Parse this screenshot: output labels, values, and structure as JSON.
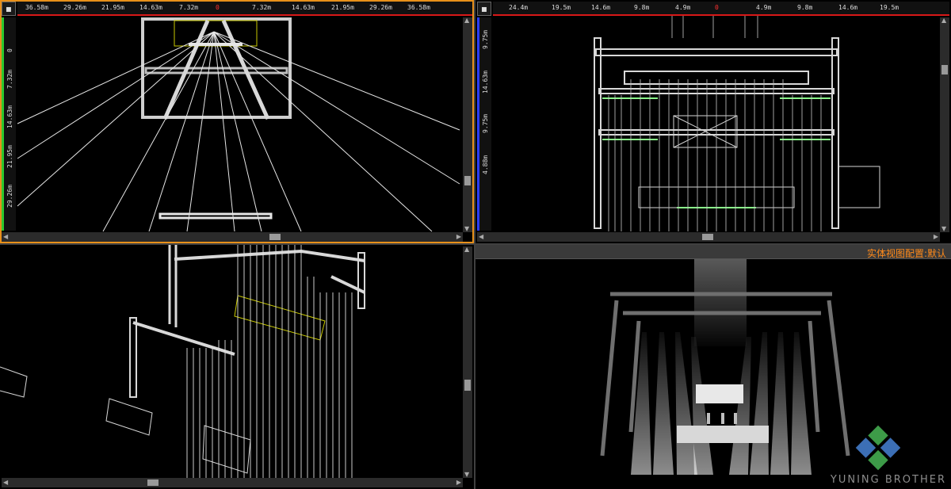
{
  "viewports": {
    "front": {
      "ruler_x": [
        "36.58m",
        "29.26m",
        "21.95m",
        "14.63m",
        "7.32m",
        "0",
        "7.32m",
        "14.63m",
        "21.95m",
        "29.26m",
        "36.58m"
      ],
      "ruler_y": [
        "0",
        "7.32m",
        "14.63m",
        "21.95m",
        "29.26m"
      ]
    },
    "side": {
      "ruler_x": [
        "24.4m",
        "19.5m",
        "14.6m",
        "9.8m",
        "4.9m",
        "0",
        "4.9m",
        "9.8m",
        "14.6m",
        "19.5m"
      ],
      "ruler_y": [
        "9.75m",
        "14.63m",
        "9.75m",
        "4.88m"
      ]
    },
    "render": {
      "title": "实体视图配置:默认"
    }
  },
  "watermark": "YUNING BROTHER",
  "colors": {
    "active_border": "#e8901a",
    "ruler_red": "#d81818",
    "title_orange": "#ff8a1a"
  }
}
